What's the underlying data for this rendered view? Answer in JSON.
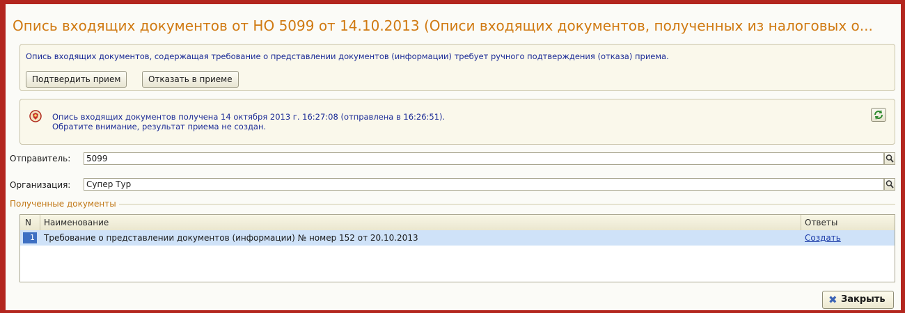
{
  "window": {
    "title": "Опись входящих документов от НО 5099 от 14.10.2013 (Описи входящих документов, полученных из налоговых о..."
  },
  "confirm_panel": {
    "message": "Опись входящих документов, содержащая требование о представлении документов  (информации) требует ручного подтверждения (отказа) приема.",
    "confirm_label": "Подтвердить прием",
    "reject_label": "Отказать в приеме"
  },
  "status_panel": {
    "line1": "Опись входящих документов получена 14 октября 2013 г. 16:27:08 (отправлена в 16:26:51).",
    "line2": "Обратите внимание, результат приема не создан."
  },
  "sender": {
    "label": "Отправитель:",
    "value": "5099"
  },
  "organization": {
    "label": "Организация:",
    "value": "Супер Тур"
  },
  "documents": {
    "group_label": "Полученные документы",
    "columns": {
      "n": "N",
      "name": "Наименование",
      "answers": "Ответы"
    },
    "rows": [
      {
        "n": "1",
        "name": "Требование о представлении документов (информации) № номер 152 от 20.10.2013",
        "answer": "Создать"
      }
    ]
  },
  "footer": {
    "close_label": "Закрыть"
  },
  "colors": {
    "frame": "#b3261e",
    "title": "#d07a12",
    "info_text": "#1a2a96",
    "selection": "#cfe2f8"
  }
}
